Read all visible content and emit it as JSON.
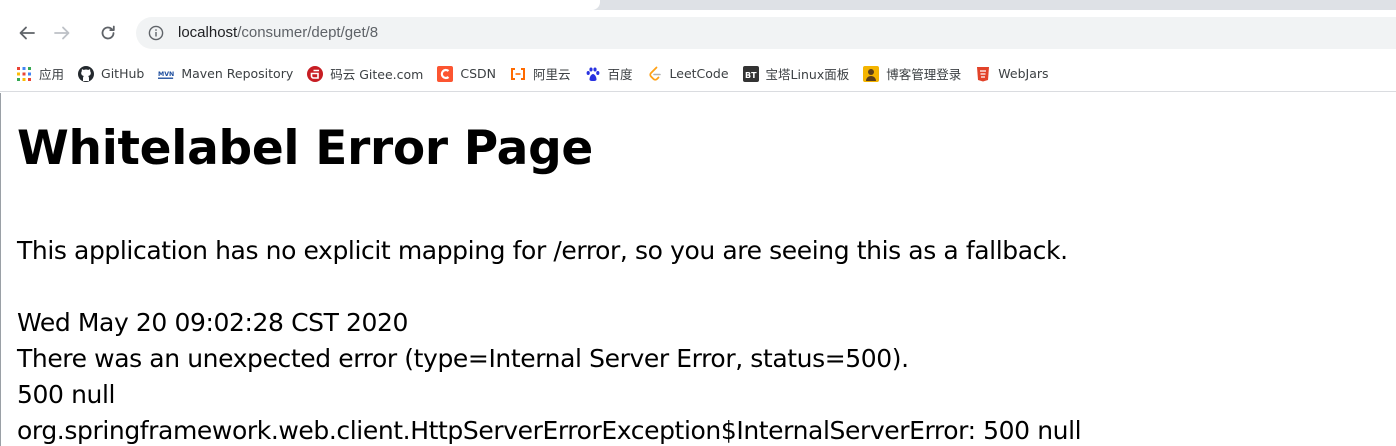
{
  "browser": {
    "nav": {
      "back_icon": "arrow-left-icon",
      "forward_icon": "arrow-right-icon",
      "reload_icon": "reload-icon"
    },
    "address_bar": {
      "info_icon": "info-icon",
      "host": "localhost",
      "path": "/consumer/dept/get/8"
    },
    "bookmarks": [
      {
        "label": "应用",
        "icon": "apps-grid-icon"
      },
      {
        "label": "GitHub",
        "icon": "github-icon"
      },
      {
        "label": "Maven Repository",
        "icon": "maven-icon"
      },
      {
        "label": "码云 Gitee.com",
        "icon": "gitee-icon"
      },
      {
        "label": "CSDN",
        "icon": "csdn-icon"
      },
      {
        "label": "阿里云",
        "icon": "aliyun-icon"
      },
      {
        "label": "百度",
        "icon": "baidu-paw-icon"
      },
      {
        "label": "LeetCode",
        "icon": "leetcode-icon"
      },
      {
        "label": "宝塔Linux面板",
        "icon": "bt-panel-icon"
      },
      {
        "label": "博客管理登录",
        "icon": "blog-admin-icon"
      },
      {
        "label": "WebJars",
        "icon": "webjars-icon"
      }
    ]
  },
  "page": {
    "heading": "Whitelabel Error Page",
    "description": "This application has no explicit mapping for /error, so you are seeing this as a fallback.",
    "timestamp": "Wed May 20 09:02:28 CST 2020",
    "error_line": "There was an unexpected error (type=Internal Server Error, status=500).",
    "message": "500 null",
    "exception": "org.springframework.web.client.HttpServerErrorException$InternalServerError: 500 null"
  },
  "colors": {
    "accent_github": "#24292e",
    "accent_maven": "#1a4b9c",
    "accent_gitee": "#c71d23",
    "accent_csdn": "#fc5531",
    "accent_aliyun": "#ff6a00",
    "accent_baidu": "#2932e1",
    "accent_leetcode": "#ffa116",
    "accent_bt": "#20a53a",
    "accent_webjars": "#e24329"
  }
}
